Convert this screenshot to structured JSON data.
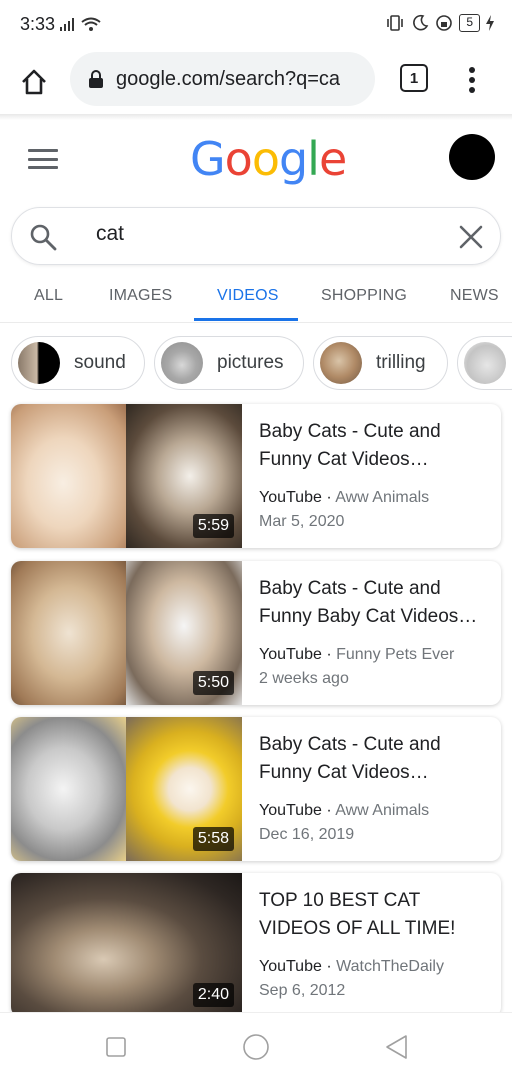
{
  "status_bar": {
    "time": "3:33",
    "battery": "5"
  },
  "browser": {
    "url": "google.com/search?q=ca",
    "tab_count": "1"
  },
  "google": {
    "logo_letters": [
      "G",
      "o",
      "o",
      "g",
      "l",
      "e"
    ],
    "logo_colors": [
      "#4285f4",
      "#ea4335",
      "#fbbc05",
      "#4285f4",
      "#34a853",
      "#ea4335"
    ]
  },
  "search": {
    "query": "cat"
  },
  "tabs": [
    {
      "label": "ALL"
    },
    {
      "label": "IMAGES"
    },
    {
      "label": "VIDEOS",
      "active": true
    },
    {
      "label": "SHOPPING"
    },
    {
      "label": "NEWS"
    }
  ],
  "chips": [
    {
      "label": "sound"
    },
    {
      "label": "pictures"
    },
    {
      "label": "trilling"
    }
  ],
  "videos": [
    {
      "title": "Baby Cats - Cute and Funny Cat Videos…",
      "source": "YouTube",
      "channel": "Aww Animals",
      "date": "Mar 5, 2020",
      "duration": "5:59"
    },
    {
      "title": "Baby Cats - Cute and Funny Baby Cat Videos…",
      "source": "YouTube",
      "channel": "Funny Pets Ever",
      "date": "2 weeks ago",
      "duration": "5:50"
    },
    {
      "title": "Baby Cats - Cute and Funny Cat Videos…",
      "source": "YouTube",
      "channel": "Aww Animals",
      "date": "Dec 16, 2019",
      "duration": "5:58"
    },
    {
      "title": "TOP 10 BEST CAT VIDEOS OF ALL TIME!",
      "source": "YouTube",
      "channel": "WatchTheDaily",
      "date": "Sep 6, 2012",
      "duration": "2:40"
    }
  ],
  "colors": {
    "accent": "#1a73e8",
    "text": "#202124",
    "muted": "#70757a"
  }
}
